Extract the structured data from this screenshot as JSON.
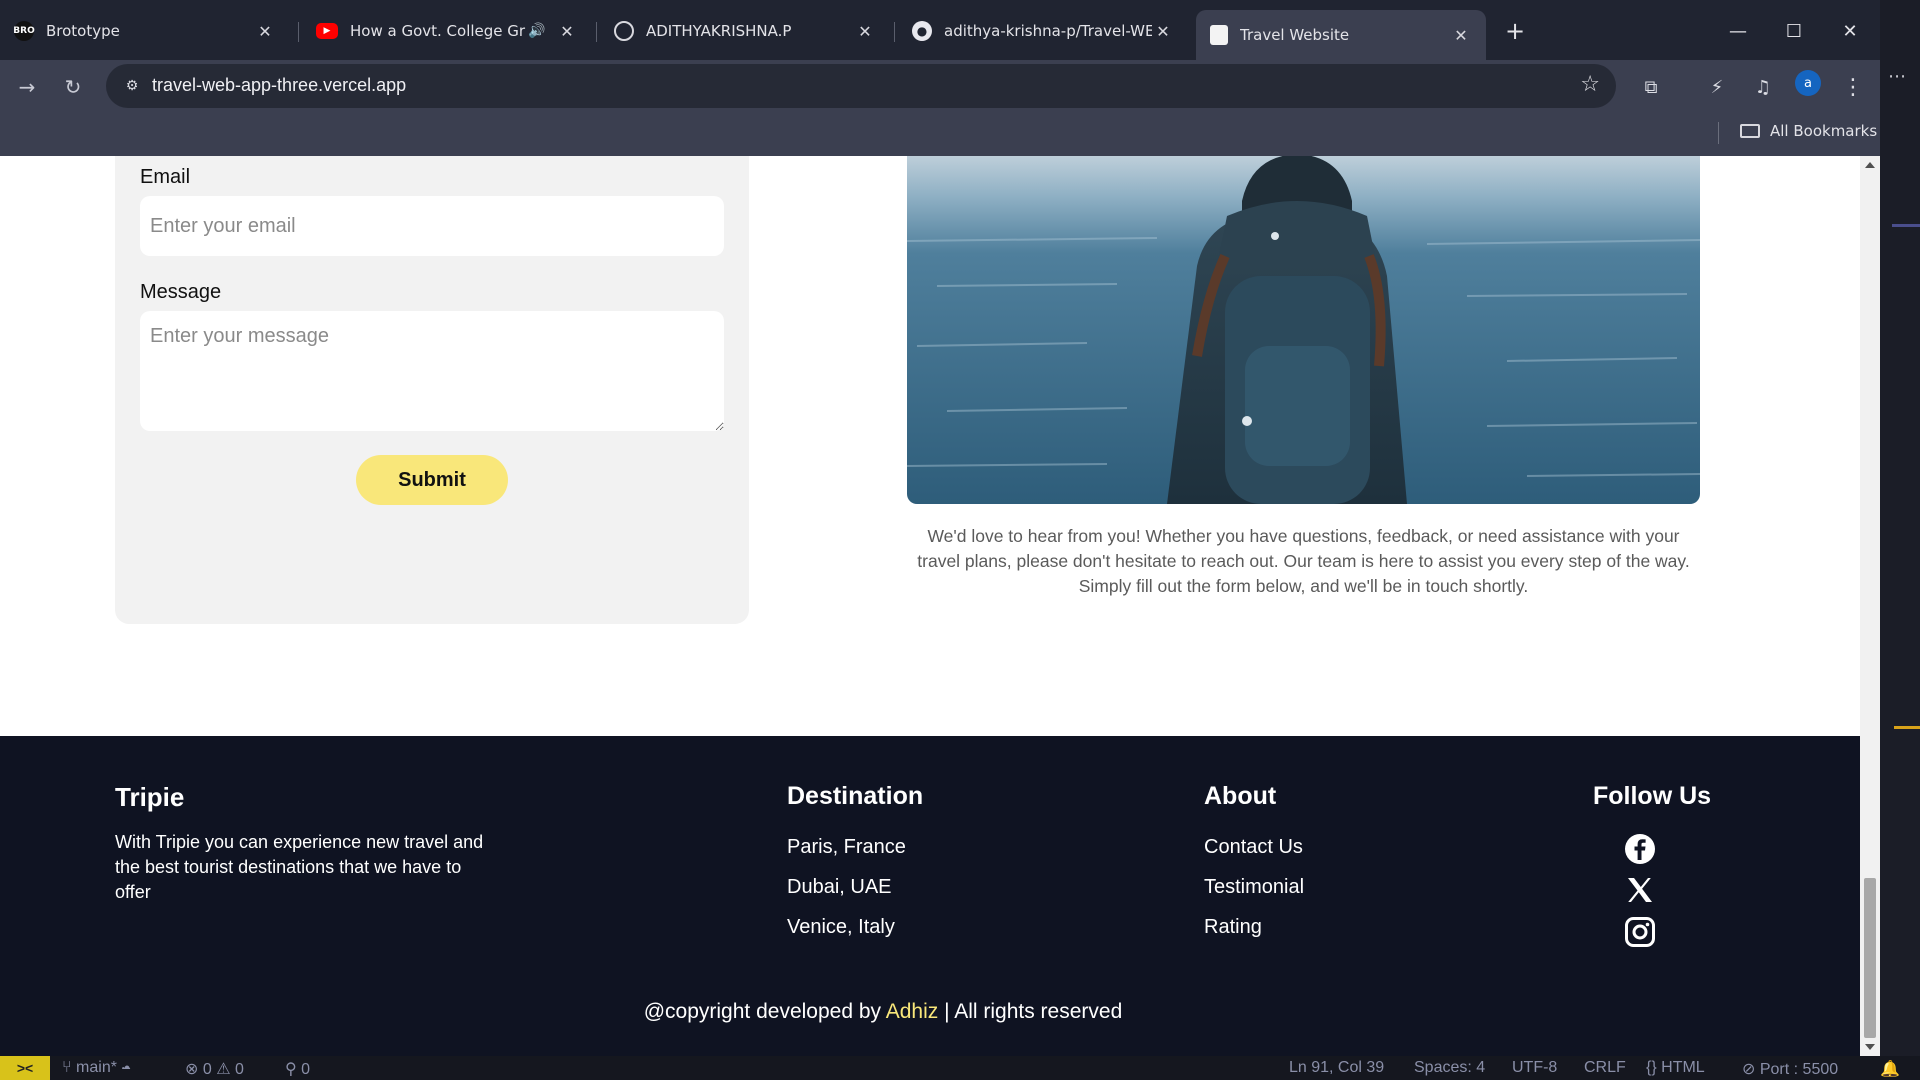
{
  "tabs": [
    {
      "title": "Brototype",
      "favicon": "bro-logo-icon"
    },
    {
      "title": "How a Govt. College Grad B",
      "favicon": "youtube-icon"
    },
    {
      "title": "ADITHYAKRISHNA.P",
      "favicon": "globe-icon"
    },
    {
      "title": "adithya-krishna-p/Travel-WEB-/",
      "favicon": "github-icon"
    },
    {
      "title": "Travel Website",
      "favicon": "page-icon"
    }
  ],
  "address_bar": {
    "url": "travel-web-app-three.vercel.app"
  },
  "profile_initial": "a",
  "bookmarks": {
    "all_label": "All Bookmarks"
  },
  "contact_form": {
    "email_label": "Email",
    "email_placeholder": "Enter your email",
    "message_label": "Message",
    "message_placeholder": "Enter your message",
    "submit_label": "Submit"
  },
  "contact_text": "We'd love to hear from you! Whether you have questions, feedback, or need assistance with your travel plans, please don't hesitate to reach out. Our team is here to assist you every step of the way. Simply fill out the form below, and we'll be in touch shortly.",
  "footer": {
    "brand": "Tripie",
    "description": "With Tripie you can experience new travel and the best tourist destinations that we have to offer",
    "destination": {
      "heading": "Destination",
      "links": [
        "Paris, France",
        "Dubai, UAE",
        "Venice, Italy"
      ]
    },
    "about": {
      "heading": "About",
      "links": [
        "Contact Us",
        "Testimonial",
        "Rating"
      ]
    },
    "follow": {
      "heading": "Follow Us",
      "icons": [
        "facebook-icon",
        "x-icon",
        "instagram-icon"
      ]
    },
    "copyright_prefix": "@copyright developed by ",
    "copyright_name": "Adhiz",
    "copyright_suffix": " | All rights reserved"
  },
  "statusbar": {
    "branch": "main*",
    "errors": "0",
    "warnings": "0",
    "ports": "0",
    "position": "Ln 91, Col 39",
    "spaces": "Spaces: 4",
    "encoding": "UTF-8",
    "eol": "CRLF",
    "language": "HTML",
    "port": "Port : 5500"
  },
  "colors": {
    "accent_yellow": "#f9e77a",
    "footer_bg": "#0f1322",
    "form_bg": "#f2f2f2"
  }
}
